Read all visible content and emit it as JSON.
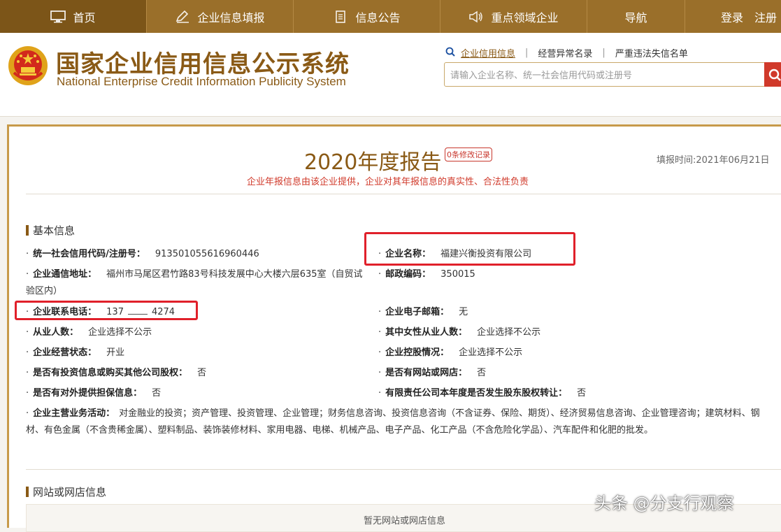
{
  "nav": {
    "items": [
      {
        "label": "首页",
        "icon": "monitor-icon"
      },
      {
        "label": "企业信息填报",
        "icon": "edit-icon"
      },
      {
        "label": "信息公告",
        "icon": "document-icon"
      },
      {
        "label": "重点领域企业",
        "icon": "speaker-icon"
      },
      {
        "label": "导航",
        "icon": ""
      }
    ],
    "login": "登录",
    "register": "注册"
  },
  "header": {
    "title_cn": "国家企业信用信息公示系统",
    "title_en": "National Enterprise Credit Information Publicity System",
    "search_tabs": [
      "企业信用信息",
      "经营异常名录",
      "严重违法失信名单"
    ],
    "search_placeholder": "请输入企业名称、统一社会信用代码或注册号"
  },
  "report": {
    "title": "2020年度报告",
    "revise_badge": "0条修改记录",
    "fill_time": "填报时间:2021年06月21日",
    "disclaimer": "企业年报信息由该企业提供，企业对其年报信息的真实性、合法性负责"
  },
  "basic": {
    "section_title": "基本信息",
    "credit_code": {
      "label": "统一社会信用代码/注册号：",
      "value": "913501055616960446"
    },
    "company_name": {
      "label": "企业名称：",
      "value": "福建兴衡投资有限公司"
    },
    "address": {
      "label": "企业通信地址：",
      "value": "福州市马尾区君竹路83号科技发展中心大楼六层635室（自贸试验区内）"
    },
    "postcode": {
      "label": "邮政编码：",
      "value": "350015"
    },
    "phone": {
      "label": "企业联系电话：",
      "value_start": "137",
      "value_end": "4274"
    },
    "email": {
      "label": "企业电子邮箱：",
      "value": "无"
    },
    "employees": {
      "label": "从业人数：",
      "value": "企业选择不公示"
    },
    "female_employees": {
      "label": "其中女性从业人数：",
      "value": "企业选择不公示"
    },
    "status": {
      "label": "企业经营状态：",
      "value": "开业"
    },
    "holding": {
      "label": "企业控股情况：",
      "value": "企业选择不公示"
    },
    "investment": {
      "label": "是否有投资信息或购买其他公司股权：",
      "value": "否"
    },
    "website": {
      "label": "是否有网站或网店：",
      "value": "否"
    },
    "guarantee": {
      "label": "是否有对外提供担保信息：",
      "value": "否"
    },
    "equity_transfer": {
      "label": "有限责任公司本年度是否发生股东股权转让：",
      "value": "否"
    },
    "business_scope": {
      "label": "企业主营业务活动：",
      "value": "对金融业的投资；资产管理、投资管理、企业管理；财务信息咨询、投资信息咨询（不含证券、保险、期货）、经济贸易信息咨询、企业管理咨询；建筑材料、钢材、有色金属（不含贵稀金属）、塑料制品、装饰装修材料、家用电器、电梯、机械产品、电子产品、化工产品（不含危险化学品）、汽车配件和化肥的批发。"
    }
  },
  "web_section": {
    "title": "网站或网店信息",
    "empty": "暂无网站或网店信息"
  },
  "watermark": "头条 @分支行观察",
  "colors": {
    "nav_bg": "#9a6f2a",
    "brand": "#8a5a16",
    "alert": "#d0392a"
  }
}
